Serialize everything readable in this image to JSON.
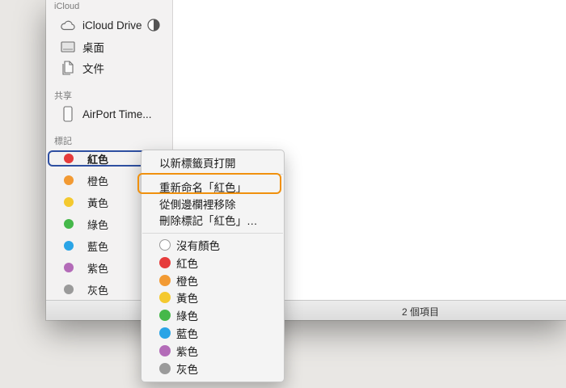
{
  "sidebar": {
    "icloud_header": "iCloud",
    "icloud_items": [
      {
        "label": "iCloud Drive",
        "icon": "cloud-icon"
      },
      {
        "label": "桌面",
        "icon": "desktop-icon"
      },
      {
        "label": "文件",
        "icon": "documents-icon"
      }
    ],
    "shared_header": "共享",
    "shared_items": [
      {
        "label": "AirPort Time...",
        "icon": "airport-device-icon"
      }
    ],
    "tags_header": "標記",
    "tags": [
      {
        "label": "紅色",
        "color": "#e63b3b"
      },
      {
        "label": "橙色",
        "color": "#f29a33"
      },
      {
        "label": "黃色",
        "color": "#f4c92f"
      },
      {
        "label": "綠色",
        "color": "#45b84a"
      },
      {
        "label": "藍色",
        "color": "#2aa4e6"
      },
      {
        "label": "紫色",
        "color": "#b36bb8"
      },
      {
        "label": "灰色",
        "color": "#9a9a9a"
      }
    ],
    "selected_tag_index": 0
  },
  "status": {
    "item_count": "2 個項目"
  },
  "context_menu": {
    "items": [
      {
        "label": "以新標籤頁打開"
      },
      {
        "label": "重新命名「紅色」"
      },
      {
        "label": "從側邊欄裡移除"
      },
      {
        "label": "刪除標記「紅色」…"
      }
    ],
    "highlighted_index": 1,
    "colors": [
      {
        "label": "沒有顏色",
        "color": ""
      },
      {
        "label": "紅色",
        "color": "#e63b3b"
      },
      {
        "label": "橙色",
        "color": "#f29a33"
      },
      {
        "label": "黃色",
        "color": "#f4c92f"
      },
      {
        "label": "綠色",
        "color": "#45b84a"
      },
      {
        "label": "藍色",
        "color": "#2aa4e6"
      },
      {
        "label": "紫色",
        "color": "#b36bb8"
      },
      {
        "label": "灰色",
        "color": "#9a9a9a"
      }
    ]
  },
  "colors": {
    "highlight_outline": "#f0900d",
    "selection_outline": "#2e4fa1"
  }
}
